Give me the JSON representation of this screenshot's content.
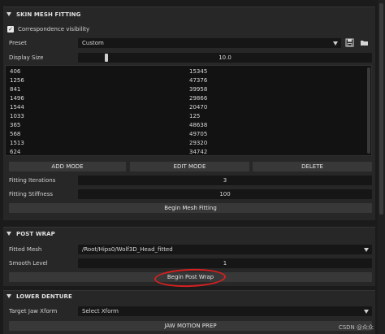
{
  "skin_mesh_fitting": {
    "title": "SKIN MESH FITTING",
    "correspondence_visibility": {
      "label": "Correspondence visibility",
      "checked": true
    },
    "preset": {
      "label": "Preset",
      "value": "Custom"
    },
    "display_size": {
      "label": "Display Size",
      "value": "10.0",
      "fraction": 0.1
    },
    "table_rows": [
      [
        "406",
        "15345"
      ],
      [
        "1256",
        "47376"
      ],
      [
        "841",
        "39958"
      ],
      [
        "1496",
        "29866"
      ],
      [
        "1544",
        "20470"
      ],
      [
        "1033",
        "125"
      ],
      [
        "365",
        "48638"
      ],
      [
        "568",
        "49705"
      ],
      [
        "1513",
        "29320"
      ],
      [
        "624",
        "34742"
      ]
    ],
    "add_mode_label": "ADD MODE",
    "edit_mode_label": "EDIT MODE",
    "delete_label": "DELETE",
    "fitting_iterations": {
      "label": "Fitting Iterations",
      "value": "3"
    },
    "fitting_stiffness": {
      "label": "Fitting Stiffness",
      "value": "100"
    },
    "begin_label": "Begin Mesh Fitting"
  },
  "post_wrap": {
    "title": "POST WRAP",
    "fitted_mesh": {
      "label": "Fitted Mesh",
      "value": "/Root/Hips0/Wolf3D_Head_fitted"
    },
    "smooth_level": {
      "label": "Smooth Level",
      "value": "1"
    },
    "begin_label": "Begin Post Wrap"
  },
  "lower_denture": {
    "title": "LOWER DENTURE",
    "target_jaw_xform": {
      "label": "Target Jaw Xform",
      "value": "Select Xform"
    },
    "jaw_motion_prep_label": "JAW MOTION PREP"
  },
  "watermark": "CSDN @众众",
  "colors": {
    "background": "#1b1b1b",
    "panel": "#272727",
    "field": "#161616",
    "button": "#383838",
    "annotation": "#d62020"
  }
}
